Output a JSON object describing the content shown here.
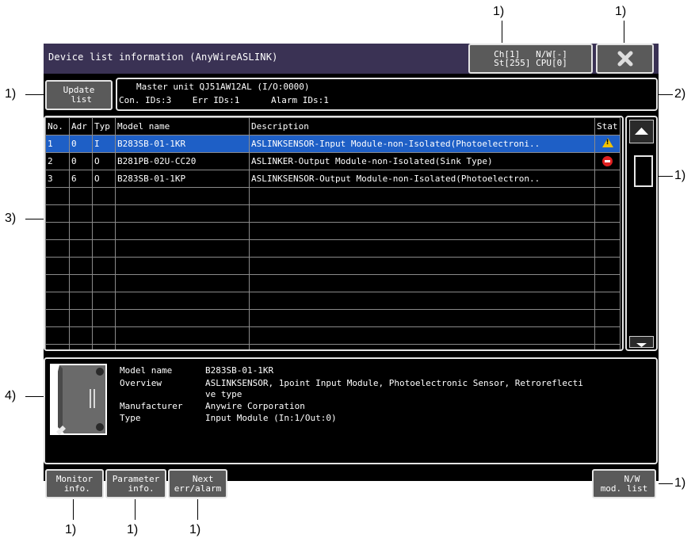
{
  "callouts": {
    "c1": "1)",
    "c2": "2)",
    "c3": "3)",
    "c4": "4)"
  },
  "title": "Device list information (AnyWireASLINK)",
  "channel": {
    "line1": "Ch[1]   N/W[-]",
    "line2": "St[255] CPU[0]"
  },
  "close_icon": "close-x-icon",
  "update_button": "Update\n list",
  "master": {
    "line1": "Master unit QJ51AW12AL (I/O:0000)",
    "line2": "Con. IDs:3    Err IDs:1      Alarm IDs:1"
  },
  "table": {
    "headers": [
      "No.",
      "Adr",
      "Typ",
      "Model name",
      "Description",
      "Stat"
    ],
    "rows": [
      {
        "no": "1",
        "adr": "0",
        "typ": "I",
        "model": "B283SB-01-1KR",
        "desc": "ASLINKSENSOR-Input Module-non-Isolated(Photoelectroni..",
        "status": "warning-icon",
        "selected": true
      },
      {
        "no": "2",
        "adr": "0",
        "typ": "O",
        "model": "B281PB-02U-CC20",
        "desc": "ASLINKER-Output Module-non-Isolated(Sink Type)",
        "status": "error-icon",
        "selected": false
      },
      {
        "no": "3",
        "adr": "6",
        "typ": "O",
        "model": "B283SB-01-1KP",
        "desc": "ASLINKSENSOR-Output Module-non-Isolated(Photoelectron..",
        "status": "",
        "selected": false
      }
    ]
  },
  "detail": {
    "model_label": "Model name",
    "model_value": "B283SB-01-1KR",
    "overview_label": "Overview",
    "overview_value1": "ASLINKSENSOR, 1point Input Module, Photoelectronic Sensor, Retroreflecti",
    "overview_value2": "ve type",
    "manufacturer_label": "Manufacturer",
    "manufacturer_value": "Anywire Corporation",
    "type_label": "Type",
    "type_value": "Input Module (In:1/Out:0)"
  },
  "buttons": {
    "monitor": "Monitor\n info.",
    "parameter": "Parameter\n  info.",
    "next": "  Next\nerr/alarm",
    "nw": "   N/W\nmod. list"
  }
}
